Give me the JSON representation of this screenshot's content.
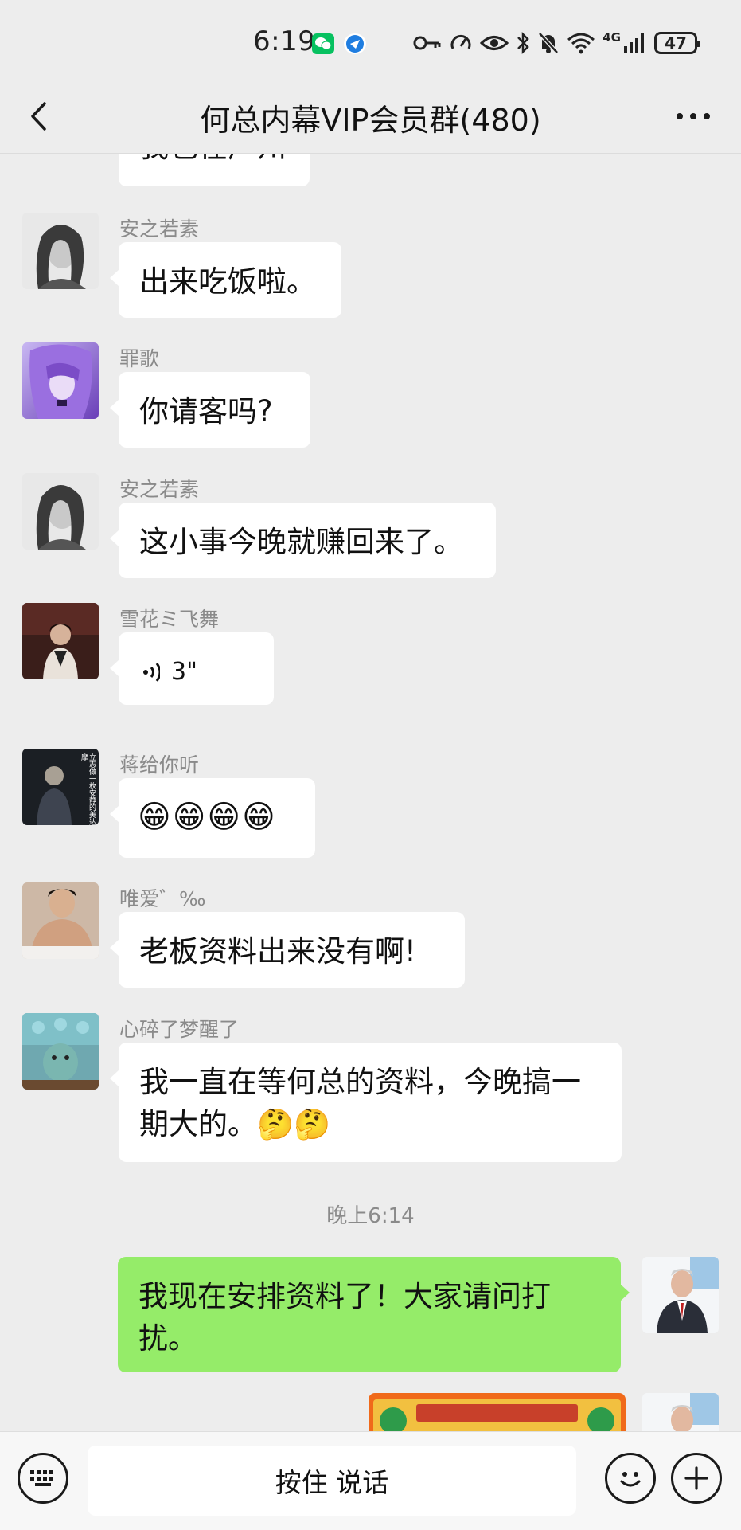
{
  "status_bar": {
    "time": "6:19",
    "battery": "47",
    "network": "4G",
    "icons": [
      "wechat-icon",
      "browser-icon",
      "key-icon",
      "speed-icon",
      "eye-icon",
      "bluetooth-icon",
      "mute-icon",
      "wifi-icon",
      "signal-icon",
      "battery-icon"
    ]
  },
  "header": {
    "title": "何总内幕VIP会员群(480)",
    "back_icon": "chevron-left-icon",
    "more_icon": "more-dots-icon"
  },
  "messages": [
    {
      "type": "text",
      "sender": "",
      "text": "我也在广州",
      "partial": true
    },
    {
      "type": "text",
      "sender": "安之若素",
      "text": "出来吃饭啦。"
    },
    {
      "type": "text",
      "sender": "罪歌",
      "text": "你请客吗?"
    },
    {
      "type": "text",
      "sender": "安之若素",
      "text": "这小事今晚就赚回来了。"
    },
    {
      "type": "voice",
      "sender": "雪花ミ飞舞",
      "duration": "3\""
    },
    {
      "type": "emoji",
      "sender": "蒋给你听",
      "emoji": "😁😁😁😁",
      "avatar_text": "立志做一枚安静的美达摩"
    },
    {
      "type": "text",
      "sender": "唯爱゛‰",
      "text": "老板资料出来没有啊!"
    },
    {
      "type": "text",
      "sender": "心碎了梦醒了",
      "text": "我一直在等何总的资料，今晚搞一期大的。🤔🤔"
    },
    {
      "type": "timestamp",
      "text": "晚上6:14"
    },
    {
      "type": "text",
      "mine": true,
      "text": "我现在安排资料了！大家请问打扰。"
    },
    {
      "type": "image",
      "mine": true,
      "partial": true
    }
  ],
  "input_bar": {
    "hold_to_talk": "按住 说话",
    "keyboard_icon": "keyboard-icon",
    "emoji_icon": "emoji-icon",
    "plus_icon": "plus-icon"
  },
  "colors": {
    "background": "#ededed",
    "my_bubble": "#95ec69",
    "other_bubble": "#ffffff",
    "meta_text": "#8a8a8a"
  }
}
